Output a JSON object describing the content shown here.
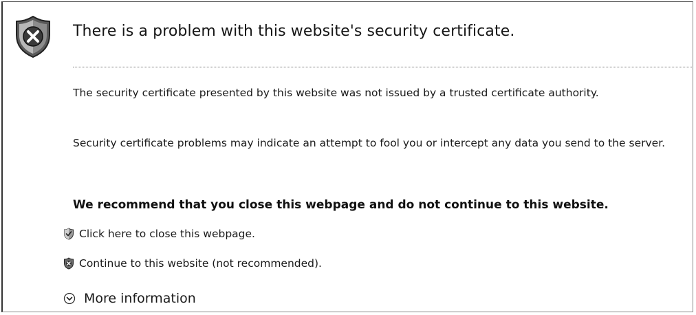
{
  "header": {
    "title": "There is a problem with this website's security certificate.",
    "icon": "shield-error-icon"
  },
  "body": {
    "paragraph1": "The security certificate presented by this website was not issued by a trusted certificate authority.",
    "paragraph2": "Security certificate problems may indicate an attempt to fool you or intercept any data you send to the server.",
    "recommendation": "We recommend that you close this webpage and do not continue to this website."
  },
  "actions": {
    "close_label": "Click here to close this webpage.",
    "close_icon": "shield-ok-icon",
    "continue_label": "Continue to this website (not recommended).",
    "continue_icon": "shield-error-icon",
    "more_info_label": "More information",
    "more_info_icon": "expand-circle-icon"
  }
}
